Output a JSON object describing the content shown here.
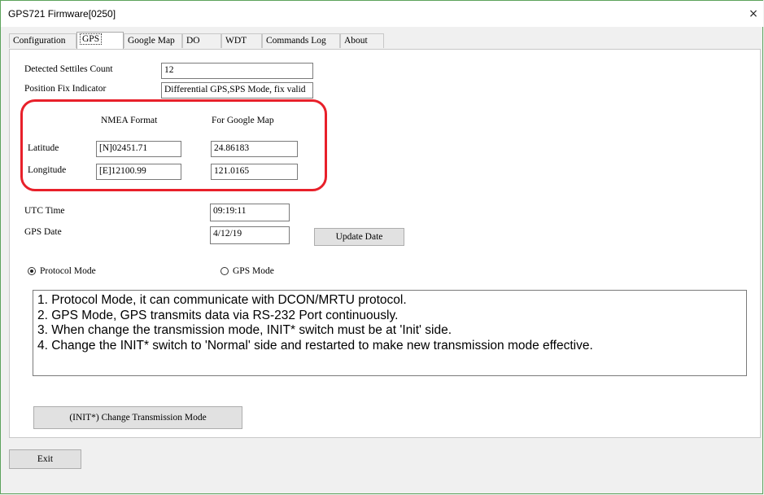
{
  "window": {
    "title": "GPS721 Firmware[0250]",
    "close_glyph": "×"
  },
  "tabs": [
    {
      "label": "Configuration"
    },
    {
      "label": "GPS"
    },
    {
      "label": "Google Map"
    },
    {
      "label": "DO"
    },
    {
      "label": "WDT"
    },
    {
      "label": "Commands Log"
    },
    {
      "label": "About"
    }
  ],
  "active_tab": "GPS",
  "gps": {
    "satellites_label": "Detected Settiles Count",
    "satellites_value": "12",
    "fix_label": "Position Fix Indicator",
    "fix_value": "Differential GPS,SPS Mode, fix valid",
    "nmea_header": "NMEA Format",
    "google_header": "For Google Map",
    "latitude_label": "Latitude",
    "latitude_nmea": "[N]02451.71",
    "latitude_google": "24.86183",
    "longitude_label": "Longitude",
    "longitude_nmea": "[E]12100.99",
    "longitude_google": "121.0165",
    "utc_label": "UTC Time",
    "utc_value": "09:19:11",
    "date_label": "GPS Date",
    "date_value": "4/12/19",
    "update_date_button": "Update Date"
  },
  "mode": {
    "protocol_label": "Protocol Mode",
    "gps_label": "GPS Mode",
    "selected": "Protocol Mode"
  },
  "info_lines": [
    "1. Protocol Mode, it can communicate with DCON/MRTU protocol.",
    "2. GPS Mode, GPS transmits data via RS-232 Port continuously.",
    "3. When change the transmission mode, INIT* switch must be at 'Init' side.",
    "4. Change the INIT* switch to 'Normal' side and  restarted to make new transmission mode effective."
  ],
  "change_mode_button": "(INIT*) Change Transmission Mode",
  "exit_button": "Exit",
  "colors": {
    "highlight": "#e8202a",
    "window_border": "#5da35c"
  },
  "icons": {
    "close": "close-icon",
    "radio": "radio-icon"
  }
}
